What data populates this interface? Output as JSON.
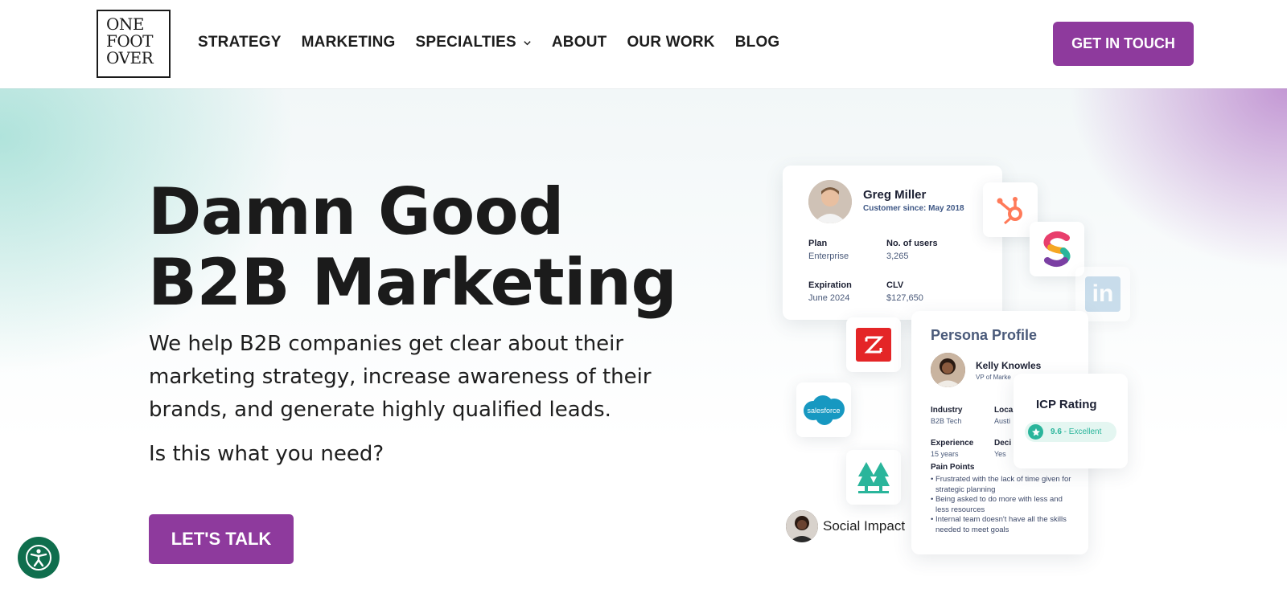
{
  "logo": {
    "lines": [
      "ONE",
      "FOOT",
      "OVER"
    ]
  },
  "nav": {
    "items": [
      {
        "label": "STRATEGY"
      },
      {
        "label": "MARKETING"
      },
      {
        "label": "SPECIALTIES"
      },
      {
        "label": "ABOUT"
      },
      {
        "label": "OUR WORK"
      },
      {
        "label": "BLOG"
      }
    ],
    "cta": "GET IN TOUCH"
  },
  "hero": {
    "headline_line1": "Damn Good",
    "headline_line2": "B2B Marketing",
    "subtext": "We help B2B companies get clear about their marketing strategy, increase awareness of their brands, and generate highly qualified leads.",
    "question": "Is this what you need?",
    "cta": "LET'S TALK"
  },
  "customer_card": {
    "name": "Greg Miller",
    "since": "Customer since: May 2018",
    "plan_label": "Plan",
    "plan_value": "Enterprise",
    "users_label": "No. of users",
    "users_value": "3,265",
    "expiration_label": "Expiration",
    "expiration_value": "June 2024",
    "clv_label": "CLV",
    "clv_value": "$127,650"
  },
  "persona_card": {
    "title": "Persona Profile",
    "name": "Kelly Knowles",
    "role": "VP of Marke",
    "industry_label": "Industry",
    "industry_value": "B2B Tech",
    "location_label": "Loca",
    "location_value": "Austi",
    "experience_label": "Experience",
    "experience_value": "15 years",
    "decision_label": "Deci",
    "decision_value": "Yes",
    "pain_points_label": "Pain Points",
    "pain_points": [
      "• Frustrated with the lack of time given for strategic planning",
      "• Being asked to do more with less and less resources",
      "• Internal team doesn't have all the skills needed to meet goals"
    ]
  },
  "icp_card": {
    "title": "ICP Rating",
    "score": "9.6",
    "score_label": " - Excellent"
  },
  "salesforce_text": "salesforce",
  "linkedin_text": "in",
  "social_label": "Social Impact",
  "colors": {
    "brand_purple": "#8e3a9d",
    "teal": "#2ab59b",
    "a11y_green": "#0f6e4d",
    "hubspot_orange": "#ff7a59",
    "zoho_red": "#e42527",
    "salesforce_blue": "#1798c1"
  }
}
